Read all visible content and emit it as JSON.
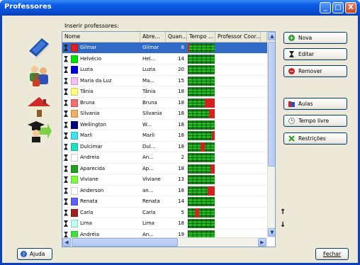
{
  "window": {
    "title": "Professores",
    "controls": {
      "minimize": "_",
      "maximize": "□",
      "close": "X"
    }
  },
  "sidebar": {
    "icons": [
      "book-icon",
      "people-icon",
      "house-icon",
      "graduate-arrow-icon"
    ]
  },
  "table": {
    "label": "Inserir professores:",
    "columns": [
      "Nome",
      "Abre...",
      "Quan...",
      "Tempo ...",
      "Professor Coor...",
      ""
    ],
    "rows": [
      {
        "nome": "Gilmar",
        "abre": "Gilmar",
        "quan": "8",
        "color": "#e02020",
        "selected": true
      },
      {
        "nome": "Helvécio",
        "abre": "Hel...",
        "quan": "14",
        "color": "#00e000",
        "selected": false
      },
      {
        "nome": "Luzia",
        "abre": "Luzia",
        "quan": "20",
        "color": "#0000e0",
        "selected": false
      },
      {
        "nome": "Maria da Luz",
        "abre": "Ma...",
        "quan": "15",
        "color": "#f8c0f0",
        "selected": false
      },
      {
        "nome": "Tânia",
        "abre": "Tânia",
        "quan": "18",
        "color": "#ffff80",
        "selected": false
      },
      {
        "nome": "Bruna",
        "abre": "Bruna",
        "quan": "18",
        "color": "#f07070",
        "selected": false
      },
      {
        "nome": "Silvania",
        "abre": "Silvania",
        "quan": "18",
        "color": "#f0b060",
        "selected": false
      },
      {
        "nome": "Wellington",
        "abre": "W...",
        "quan": "18",
        "color": "#000080",
        "selected": false
      },
      {
        "nome": "Marli",
        "abre": "Marli",
        "quan": "18",
        "color": "#40e0f0",
        "selected": false
      },
      {
        "nome": "Dulcimar",
        "abre": "Dul...",
        "quan": "18",
        "color": "#20e0c0",
        "selected": false
      },
      {
        "nome": "Andreia",
        "abre": "An...",
        "quan": "2",
        "color": "#ffffff",
        "selected": false
      },
      {
        "nome": "Aparecida",
        "abre": "Ap...",
        "quan": "18",
        "color": "#20a020",
        "selected": false
      },
      {
        "nome": "Viviane",
        "abre": "Viviane",
        "quan": "13",
        "color": "#80ff40",
        "selected": false
      },
      {
        "nome": "Anderson",
        "abre": "an...",
        "quan": "18",
        "color": "#ffffff",
        "selected": false
      },
      {
        "nome": "Renata",
        "abre": "Renata",
        "quan": "14",
        "color": "#6060ff",
        "selected": false
      },
      {
        "nome": "Carla",
        "abre": "Carla",
        "quan": "5",
        "color": "#a02020",
        "selected": false
      },
      {
        "nome": "Lima",
        "abre": "Lima",
        "quan": "18",
        "color": "#c0fff0",
        "selected": false
      },
      {
        "nome": "Andréia",
        "abre": "An...",
        "quan": "19",
        "color": "#40e040",
        "selected": false
      }
    ]
  },
  "buttons": {
    "nova": "Nova",
    "editar": "Editar",
    "remover": "Remover",
    "aulas": "Aulas",
    "tempo_livre": "Tempo livre",
    "restricoes": "Restrições"
  },
  "arrows": {
    "up": "↑",
    "down": "↓"
  },
  "footer": {
    "ajuda": "Ajuda",
    "fechar": "Fechar"
  },
  "colors": {
    "selection": "#316ac5",
    "titlebar": "#0b5ce5"
  }
}
